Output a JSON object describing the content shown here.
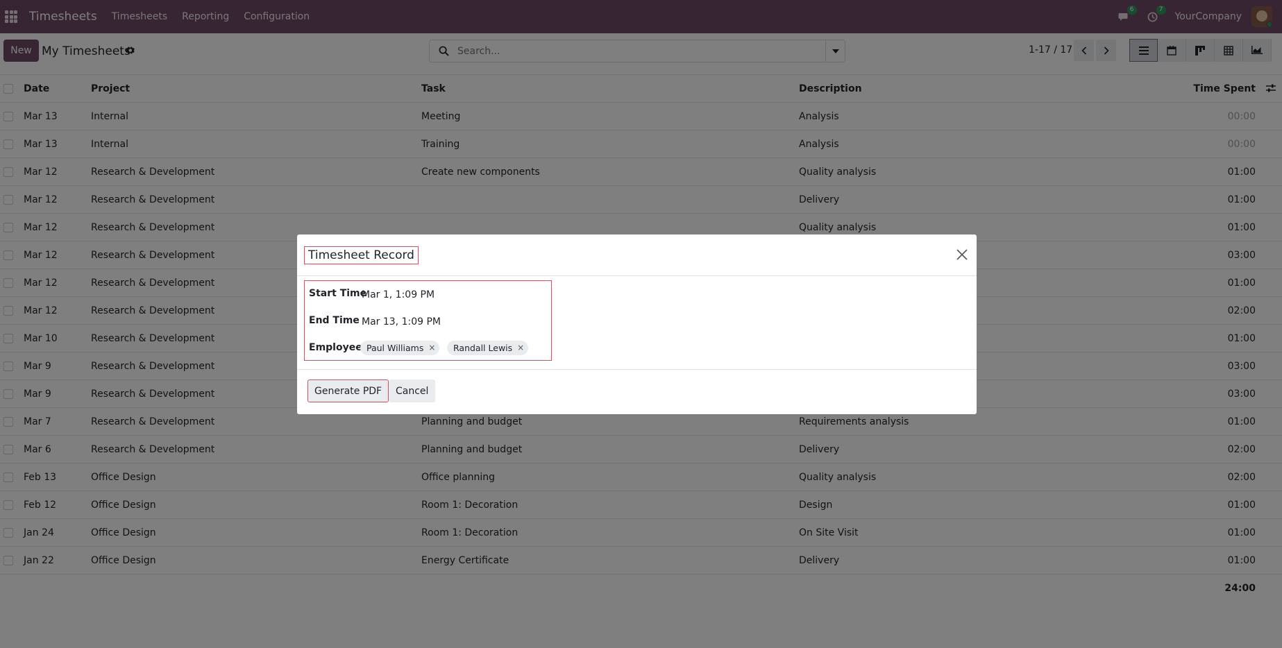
{
  "navbar": {
    "brand": "Timesheets",
    "menu": [
      "Timesheets",
      "Reporting",
      "Configuration"
    ],
    "messages_count": "6",
    "activities_count": "7",
    "company": "YourCompany"
  },
  "control": {
    "new_label": "New",
    "title": "My Timesheets",
    "search_placeholder": "Search...",
    "pager": "1-17 / 17"
  },
  "table": {
    "headers": {
      "date": "Date",
      "project": "Project",
      "task": "Task",
      "description": "Description",
      "time": "Time Spent"
    },
    "rows": [
      {
        "date": "Mar 13",
        "project": "Internal",
        "task": "Meeting",
        "description": "Analysis",
        "time": "00:00"
      },
      {
        "date": "Mar 13",
        "project": "Internal",
        "task": "Training",
        "description": "Analysis",
        "time": "00:00"
      },
      {
        "date": "Mar 12",
        "project": "Research & Development",
        "task": "Create new components",
        "description": "Quality analysis",
        "time": "01:00"
      },
      {
        "date": "Mar 12",
        "project": "Research & Development",
        "task": "",
        "description": "Delivery",
        "time": "01:00"
      },
      {
        "date": "Mar 12",
        "project": "Research & Development",
        "task": "",
        "description": "Quality analysis",
        "time": "01:00"
      },
      {
        "date": "Mar 12",
        "project": "Research & Development",
        "task": "",
        "description": "",
        "time": "03:00"
      },
      {
        "date": "Mar 12",
        "project": "Research & Development",
        "task": "",
        "description": "",
        "time": "01:00"
      },
      {
        "date": "Mar 12",
        "project": "Research & Development",
        "task": "",
        "description": "",
        "time": "02:00"
      },
      {
        "date": "Mar 10",
        "project": "Research & Development",
        "task": "",
        "description": "",
        "time": "01:00"
      },
      {
        "date": "Mar 9",
        "project": "Research & Development",
        "task": "",
        "description": "",
        "time": "03:00"
      },
      {
        "date": "Mar 9",
        "project": "Research & Development",
        "task": "",
        "description": "",
        "time": "03:00"
      },
      {
        "date": "Mar 7",
        "project": "Research & Development",
        "task": "Planning and budget",
        "description": "Requirements analysis",
        "time": "01:00"
      },
      {
        "date": "Mar 6",
        "project": "Research & Development",
        "task": "Planning and budget",
        "description": "Delivery",
        "time": "02:00"
      },
      {
        "date": "Feb 13",
        "project": "Office Design",
        "task": "Office planning",
        "description": "Quality analysis",
        "time": "02:00"
      },
      {
        "date": "Feb 12",
        "project": "Office Design",
        "task": "Room 1: Decoration",
        "description": "Design",
        "time": "01:00"
      },
      {
        "date": "Jan 24",
        "project": "Office Design",
        "task": "Room 1: Decoration",
        "description": "On Site Visit",
        "time": "01:00"
      },
      {
        "date": "Jan 22",
        "project": "Office Design",
        "task": "Energy Certificate",
        "description": "Delivery",
        "time": "01:00"
      }
    ],
    "total": "24:00"
  },
  "dialog": {
    "title": "Timesheet Record",
    "start_label": "Start Time",
    "start_value": "Mar 1, 1:09 PM",
    "end_label": "End Time",
    "end_value": "Mar 13, 1:09 PM",
    "employees_label": "Employees",
    "employees": [
      "Paul Williams",
      "Randall Lewis"
    ],
    "tag_remove": "×",
    "generate_label": "Generate PDF",
    "cancel_label": "Cancel"
  },
  "colors": {
    "brand": "#714b67",
    "badge": "#2e9a5c",
    "highlight": "#e04b55"
  }
}
